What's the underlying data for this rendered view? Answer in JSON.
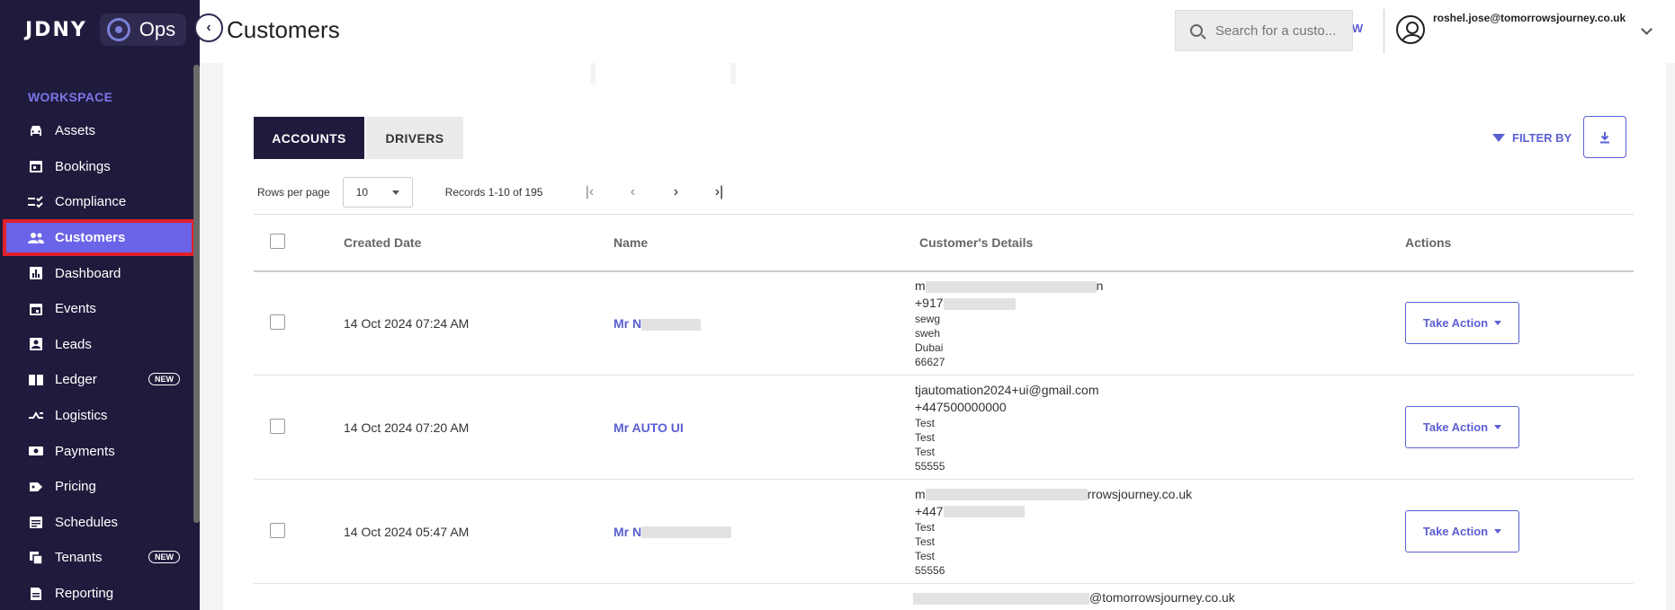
{
  "brand": {
    "logo": "JDNY",
    "product": "Ops"
  },
  "sidebar": {
    "section_label": "WORKSPACE",
    "items": [
      {
        "label": "Assets",
        "icon": "car-icon"
      },
      {
        "label": "Bookings",
        "icon": "calendar-icon"
      },
      {
        "label": "Compliance",
        "icon": "checklist-icon"
      },
      {
        "label": "Customers",
        "icon": "people-icon",
        "active": true
      },
      {
        "label": "Dashboard",
        "icon": "chart-icon"
      },
      {
        "label": "Events",
        "icon": "calendar-event-icon"
      },
      {
        "label": "Leads",
        "icon": "contact-icon"
      },
      {
        "label": "Ledger",
        "icon": "book-icon",
        "badge": "NEW"
      },
      {
        "label": "Logistics",
        "icon": "route-icon"
      },
      {
        "label": "Payments",
        "icon": "money-icon"
      },
      {
        "label": "Pricing",
        "icon": "tag-icon"
      },
      {
        "label": "Schedules",
        "icon": "schedule-icon"
      },
      {
        "label": "Tenants",
        "icon": "tenants-icon",
        "badge": "NEW"
      },
      {
        "label": "Reporting",
        "icon": "report-icon"
      }
    ]
  },
  "header": {
    "title": "Customers",
    "add_new": "ADD NEW",
    "search_placeholder": "Search for a custo...",
    "user_email": "roshel.jose@tomorrowsjourney.co.uk"
  },
  "tabs": {
    "accounts": "ACCOUNTS",
    "drivers": "DRIVERS"
  },
  "toolbar": {
    "filter_label": "FILTER BY"
  },
  "pagination": {
    "rows_per_page_label": "Rows per page",
    "rows_per_page_value": "10",
    "records": "Records 1-10 of 195"
  },
  "table": {
    "headers": {
      "created": "Created Date",
      "name": "Name",
      "details": "Customer's Details",
      "actions": "Actions"
    },
    "action_label": "Take Action",
    "rows": [
      {
        "created": "14 Oct 2024 07:24 AM",
        "name": "Mr N",
        "email": "m",
        "email_suffix": "n",
        "phone": "+917",
        "line1": "sewg",
        "line2": "sweh",
        "line3": "Dubai",
        "postcode": "66627"
      },
      {
        "created": "14 Oct 2024 07:20 AM",
        "name": "Mr AUTO UI",
        "email": "tjautomation2024+ui@gmail.com",
        "email_suffix": "",
        "phone": "+447500000000",
        "line1": "Test",
        "line2": "Test",
        "line3": "Test",
        "postcode": "55555"
      },
      {
        "created": "14 Oct 2024 05:47 AM",
        "name": "Mr N",
        "email": "m",
        "email_suffix": "rrowsjourney.co.uk",
        "phone": "+447",
        "line1": "Test",
        "line2": "Test",
        "line3": "Test",
        "postcode": "55556"
      }
    ],
    "partial_row_email_suffix": "@tomorrowsjourney.co.uk"
  }
}
